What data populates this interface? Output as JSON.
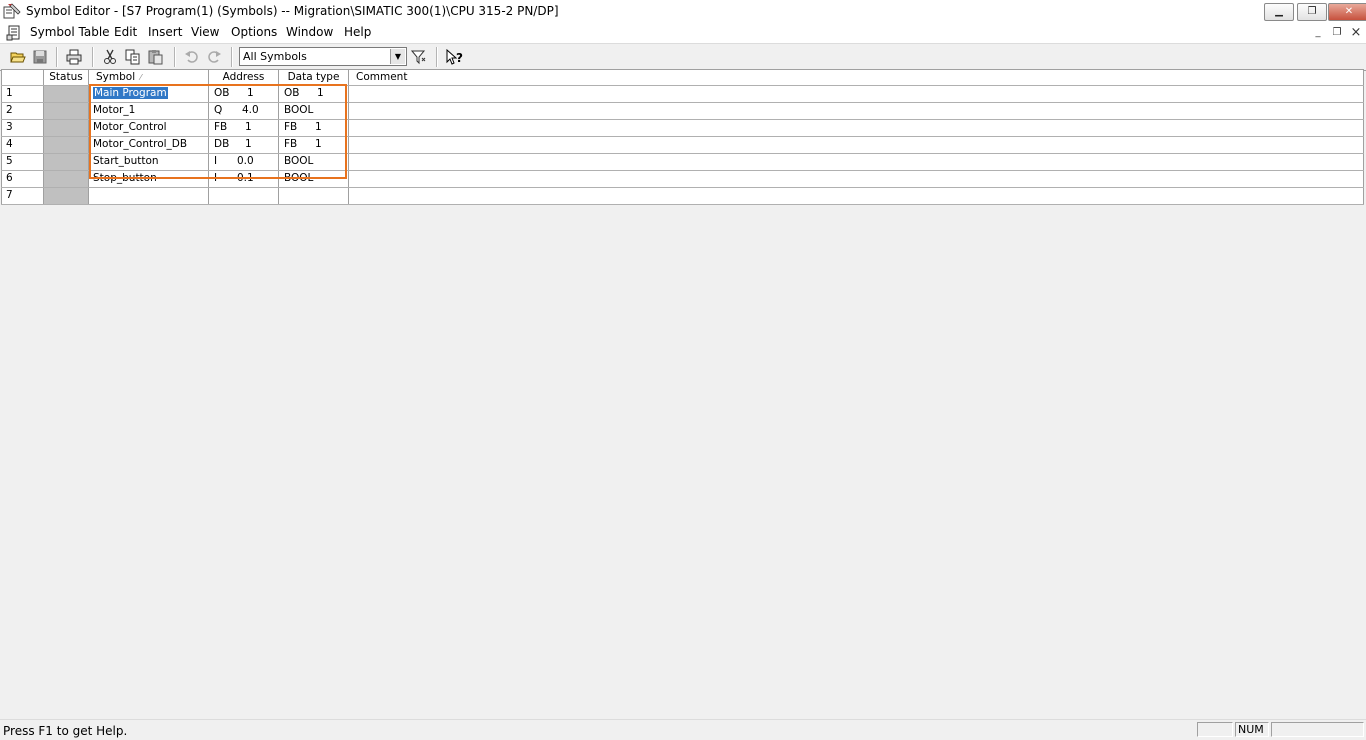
{
  "window": {
    "title": "Symbol Editor - [S7 Program(1) (Symbols) -- Migration\\SIMATIC 300(1)\\CPU 315-2 PN/DP]",
    "minimize_glyph": "▁",
    "restore_glyph": "❐",
    "close_glyph": "✕"
  },
  "menu": {
    "items": [
      "Symbol Table",
      "Edit",
      "Insert",
      "View",
      "Options",
      "Window",
      "Help"
    ],
    "mdi_minimize": "_",
    "mdi_restore": "❐",
    "mdi_close": "×"
  },
  "toolbar": {
    "icons": [
      "open-icon",
      "save-icon",
      "print-icon",
      "cut-icon",
      "copy-icon",
      "paste-icon",
      "undo-icon",
      "redo-icon",
      "filter-icon",
      "context-help-icon"
    ],
    "filter_value": "All Symbols"
  },
  "table": {
    "headers": {
      "status": "Status",
      "symbol": "Symbol",
      "address": "Address",
      "data_type": "Data type",
      "comment": "Comment"
    },
    "rows": [
      {
        "num": "1",
        "symbol": "Main Program",
        "addr_type": "OB",
        "addr_num": "1",
        "dt_type": "OB",
        "dt_num": "1",
        "comment": ""
      },
      {
        "num": "2",
        "symbol": "Motor_1",
        "addr_type": "Q",
        "addr_num": "4.0",
        "dt_type": "BOOL",
        "dt_num": "",
        "comment": ""
      },
      {
        "num": "3",
        "symbol": "Motor_Control",
        "addr_type": "FB",
        "addr_num": "1",
        "dt_type": "FB",
        "dt_num": "1",
        "comment": ""
      },
      {
        "num": "4",
        "symbol": "Motor_Control_DB",
        "addr_type": "DB",
        "addr_num": "1",
        "dt_type": "FB",
        "dt_num": "1",
        "comment": ""
      },
      {
        "num": "5",
        "symbol": "Start_button",
        "addr_type": "I",
        "addr_num": "0.0",
        "dt_type": "BOOL",
        "dt_num": "",
        "comment": ""
      },
      {
        "num": "6",
        "symbol": "Stop_button",
        "addr_type": "I",
        "addr_num": "0.1",
        "dt_type": "BOOL",
        "dt_num": "",
        "comment": ""
      },
      {
        "num": "7",
        "symbol": "",
        "addr_type": "",
        "addr_num": "",
        "dt_type": "",
        "dt_num": "",
        "comment": ""
      }
    ],
    "highlight_color": "#e8731e",
    "selection_color": "#3178c6"
  },
  "statusbar": {
    "help_text": "Press F1 to get Help.",
    "num_indicator": "NUM"
  }
}
